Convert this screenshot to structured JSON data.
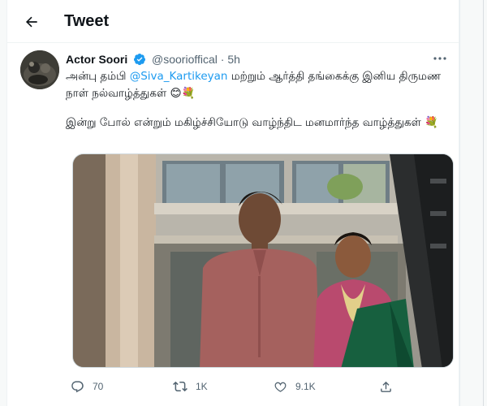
{
  "header": {
    "title": "Tweet",
    "back_icon": "back-arrow-icon"
  },
  "tweet": {
    "author": {
      "display_name": "Actor Soori",
      "handle": "@soorioffical",
      "verified": true
    },
    "separator": "·",
    "time": "5h",
    "text": {
      "line1_before": "அன்பு தம்பி ",
      "mention": "@Siva_Kartikeyan",
      "line1_after": " மற்றும் ஆர்த்தி தங்கைக்கு இனிய திருமண நாள் நல்வாழ்த்துகள் 😊💐",
      "para2": "இன்று போல் என்றும் மகிழ்ச்சியோடு வாழ்ந்திட மனமார்ந்த வாழ்த்துகள் 💐"
    },
    "stats": {
      "replies": "70",
      "retweets": "1K",
      "likes": "9.1K"
    }
  },
  "colors": {
    "accent": "#1d9bf0",
    "text": "#0f1419",
    "muted": "#536471"
  }
}
